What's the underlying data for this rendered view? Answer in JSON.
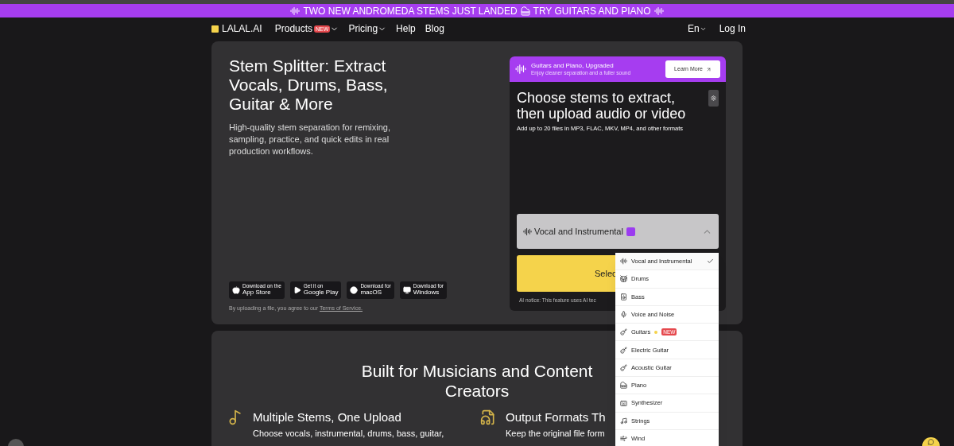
{
  "announcement": {
    "text": "TWO NEW ANDROMEDA STEMS JUST LANDED",
    "link": "TRY GUITARS AND PIANO"
  },
  "nav": {
    "logo": "LALAL.AI",
    "items": [
      {
        "label": "Products",
        "badge": "NEW",
        "dropdown": true
      },
      {
        "label": "Pricing",
        "dropdown": true
      },
      {
        "label": "Help",
        "dropdown": false
      },
      {
        "label": "Blog",
        "dropdown": false
      }
    ],
    "language": "En",
    "login": "Log In"
  },
  "hero": {
    "title": "Stem Splitter: Extract Vocals, Drums, Bass, Guitar & More",
    "description": "High-quality stem separation for remixing, sampling, practice, and quick edits in real production workflows.",
    "stores": [
      {
        "kind": "apple",
        "small": "Download on the",
        "name": "App Store"
      },
      {
        "kind": "play",
        "small": "Get it on",
        "name": "Google Play"
      },
      {
        "kind": "mac",
        "small": "Download for",
        "name": "macOS"
      },
      {
        "kind": "windows",
        "small": "Download for",
        "name": "Windows"
      }
    ],
    "terms": {
      "text": "By uploading a file, you agree to our",
      "link": "Terms of Service."
    }
  },
  "widget": {
    "promo": {
      "title": "Guitars and Piano, Upgraded",
      "subtitle": "Enjoy cleaner separation and a fuller sound",
      "button": "Learn More"
    },
    "heading": "Choose stems to extract, then upload audio or video",
    "hint": "Add up to 20 files in MP3, FLAC, MKV, MP4, and other formats",
    "select": {
      "value": "Vocal and Instrumental",
      "expanded": true
    },
    "upload_button": "Selec",
    "notice": "AI notice: This feature uses AI tec",
    "options": [
      {
        "kind": "vocal",
        "label": "Vocal and Instrumental",
        "selected": true
      },
      {
        "kind": "drums",
        "label": "Drums",
        "selected": false
      },
      {
        "kind": "bass",
        "label": "Bass",
        "selected": false
      },
      {
        "kind": "voice",
        "label": "Voice and Noise",
        "selected": false
      },
      {
        "kind": "guitars",
        "label": "Guitars",
        "badge": "NEW",
        "selected": false
      },
      {
        "kind": "electric",
        "label": "Electric Guitar",
        "selected": false
      },
      {
        "kind": "acoustic",
        "label": "Acoustic Guitar",
        "selected": false
      },
      {
        "kind": "piano",
        "label": "Piano",
        "selected": false
      },
      {
        "kind": "synth",
        "label": "Synthesizer",
        "selected": false
      },
      {
        "kind": "strings",
        "label": "Strings",
        "selected": false
      },
      {
        "kind": "wind",
        "label": "Wind",
        "selected": false
      }
    ]
  },
  "features": {
    "heading": "Built for Musicians and Content Creators",
    "items": [
      {
        "kind": "stems",
        "title": "Multiple Stems, One Upload",
        "text": "Choose vocals, instrumental, drums, bass, guitar,"
      },
      {
        "kind": "formats",
        "title": "Output Formats Th",
        "text": "Keep the original file form"
      }
    ]
  }
}
